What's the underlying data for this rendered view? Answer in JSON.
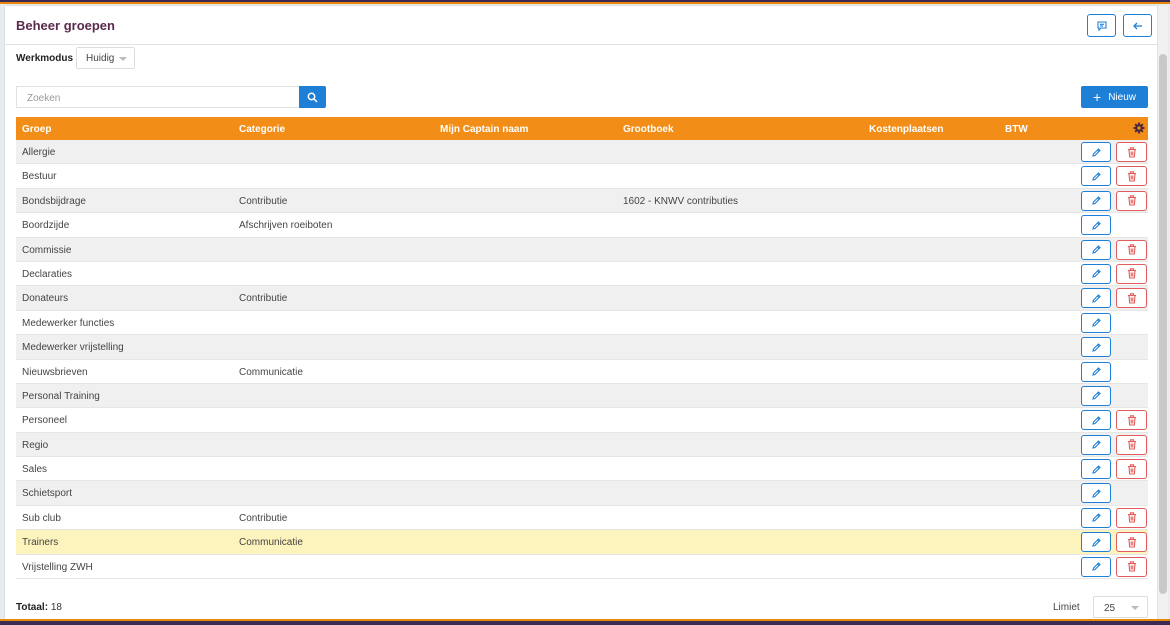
{
  "header": {
    "title": "Beheer groepen"
  },
  "werkmodus": {
    "label": "Werkmodus",
    "value": "Huidig"
  },
  "search": {
    "placeholder": "Zoeken"
  },
  "toolbar": {
    "new_label": "Nieuw"
  },
  "table": {
    "columns": [
      "Groep",
      "Categorie",
      "Mijn Captain naam",
      "Grootboek",
      "Kostenplaatsen",
      "BTW"
    ],
    "rows": [
      {
        "groep": "Allergie",
        "categorie": "",
        "grootboek": "",
        "deletable": true,
        "highlighted": false
      },
      {
        "groep": "Bestuur",
        "categorie": "",
        "grootboek": "",
        "deletable": true,
        "highlighted": false
      },
      {
        "groep": "Bondsbijdrage",
        "categorie": "Contributie",
        "grootboek": "1602 - KNWV contributies",
        "deletable": true,
        "highlighted": false
      },
      {
        "groep": "Boordzijde",
        "categorie": "Afschrijven roeiboten",
        "grootboek": "",
        "deletable": false,
        "highlighted": false
      },
      {
        "groep": "Commissie",
        "categorie": "",
        "grootboek": "",
        "deletable": true,
        "highlighted": false
      },
      {
        "groep": "Declaraties",
        "categorie": "",
        "grootboek": "",
        "deletable": true,
        "highlighted": false
      },
      {
        "groep": "Donateurs",
        "categorie": "Contributie",
        "grootboek": "",
        "deletable": true,
        "highlighted": false
      },
      {
        "groep": "Medewerker functies",
        "categorie": "",
        "grootboek": "",
        "deletable": false,
        "highlighted": false
      },
      {
        "groep": "Medewerker vrijstelling",
        "categorie": "",
        "grootboek": "",
        "deletable": false,
        "highlighted": false
      },
      {
        "groep": "Nieuwsbrieven",
        "categorie": "Communicatie",
        "grootboek": "",
        "deletable": false,
        "highlighted": false
      },
      {
        "groep": "Personal Training",
        "categorie": "",
        "grootboek": "",
        "deletable": false,
        "highlighted": false
      },
      {
        "groep": "Personeel",
        "categorie": "",
        "grootboek": "",
        "deletable": true,
        "highlighted": false
      },
      {
        "groep": "Regio",
        "categorie": "",
        "grootboek": "",
        "deletable": true,
        "highlighted": false
      },
      {
        "groep": "Sales",
        "categorie": "",
        "grootboek": "",
        "deletable": true,
        "highlighted": false
      },
      {
        "groep": "Schietsport",
        "categorie": "",
        "grootboek": "",
        "deletable": false,
        "highlighted": false
      },
      {
        "groep": "Sub club",
        "categorie": "Contributie",
        "grootboek": "",
        "deletable": true,
        "highlighted": false
      },
      {
        "groep": "Trainers",
        "categorie": "Communicatie",
        "grootboek": "",
        "deletable": true,
        "highlighted": true
      },
      {
        "groep": "Vrijstelling ZWH",
        "categorie": "",
        "grootboek": "",
        "deletable": true,
        "highlighted": false
      }
    ]
  },
  "footer": {
    "total_label": "Totaal:",
    "total_value": "18",
    "limit_label": "Limiet",
    "limit_value": "25"
  },
  "colors": {
    "accent": "#1d7fd6",
    "header_bg": "#f28e17",
    "title": "#5a2a4c",
    "delete": "#e15d5d",
    "highlight": "#fdf3bd"
  }
}
